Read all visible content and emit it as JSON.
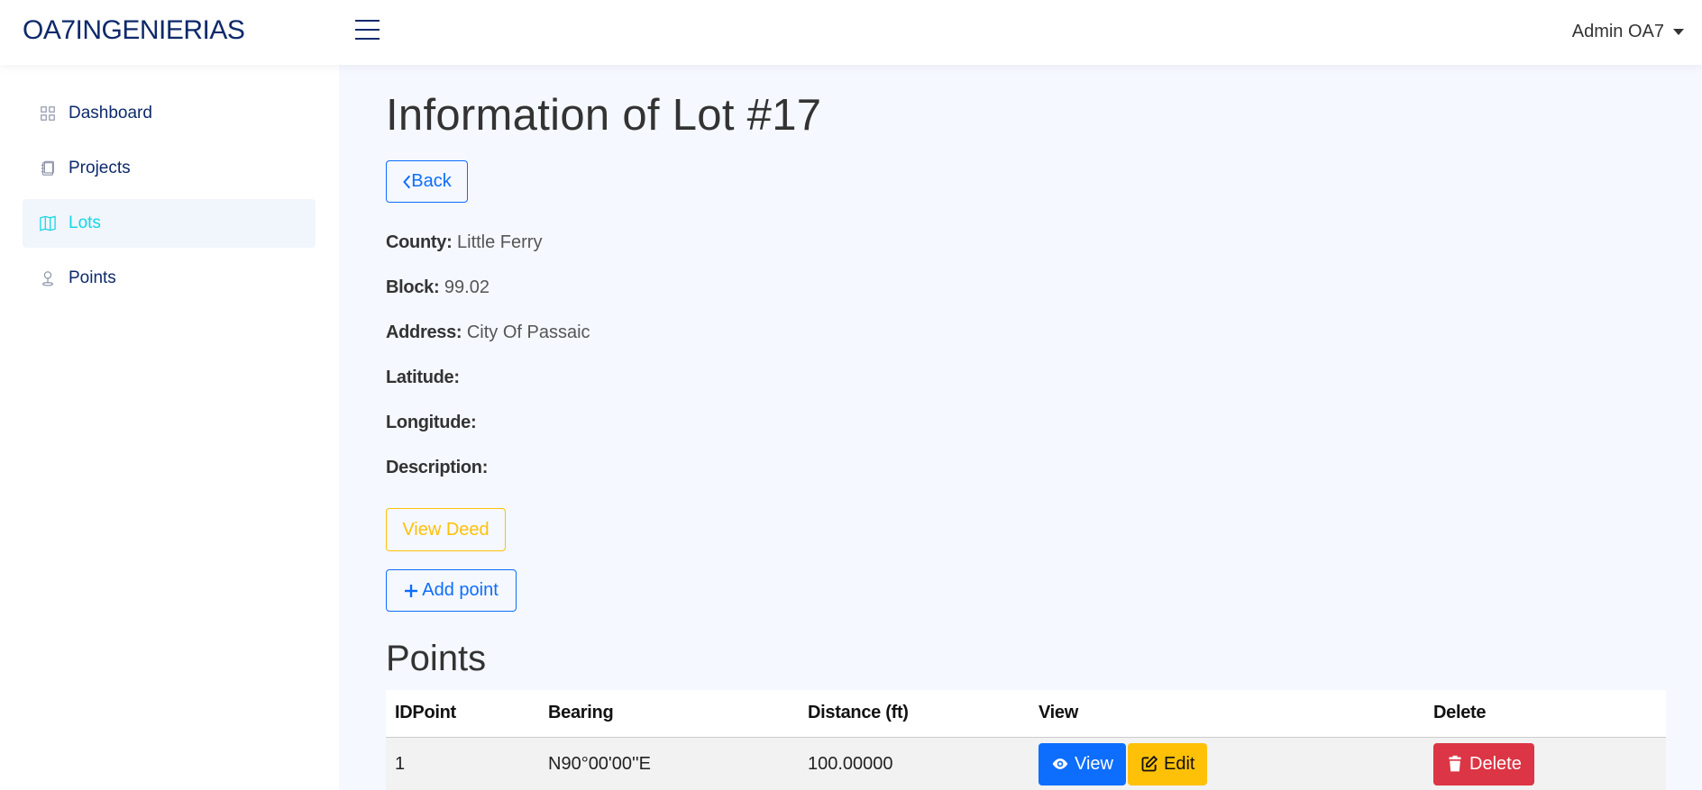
{
  "header": {
    "brand": "OA7INGENIERIAS",
    "user": "Admin OA7"
  },
  "sidebar": {
    "items": [
      {
        "label": "Dashboard",
        "icon": "grid-icon",
        "active": false
      },
      {
        "label": "Projects",
        "icon": "notebook-icon",
        "active": false
      },
      {
        "label": "Lots",
        "icon": "map-icon",
        "active": true
      },
      {
        "label": "Points",
        "icon": "pin-icon",
        "active": false
      }
    ]
  },
  "page": {
    "title": "Information of Lot #17",
    "back_label": "Back",
    "fields": {
      "county_label": "County:",
      "county": "Little Ferry",
      "block_label": "Block:",
      "block": "99.02",
      "address_label": "Address:",
      "address": "City Of Passaic",
      "latitude_label": "Latitude:",
      "latitude": "",
      "longitude_label": "Longitude:",
      "longitude": "",
      "description_label": "Description:",
      "description": ""
    },
    "view_deed_label": "View Deed",
    "add_point_label": "Add point",
    "points_title": "Points"
  },
  "table": {
    "headers": [
      "IDPoint",
      "Bearing",
      "Distance (ft)",
      "View",
      "Delete"
    ],
    "rows": [
      {
        "id": "1",
        "bearing": "N90°00'00''E",
        "distance": "100.00000",
        "view_label": "View",
        "edit_label": "Edit",
        "delete_label": "Delete"
      }
    ]
  },
  "colors": {
    "brand": "#0e2a6b",
    "active": "#13d6e6",
    "primary": "#0d6efd",
    "warning": "#ffc107",
    "danger": "#dc3545"
  }
}
